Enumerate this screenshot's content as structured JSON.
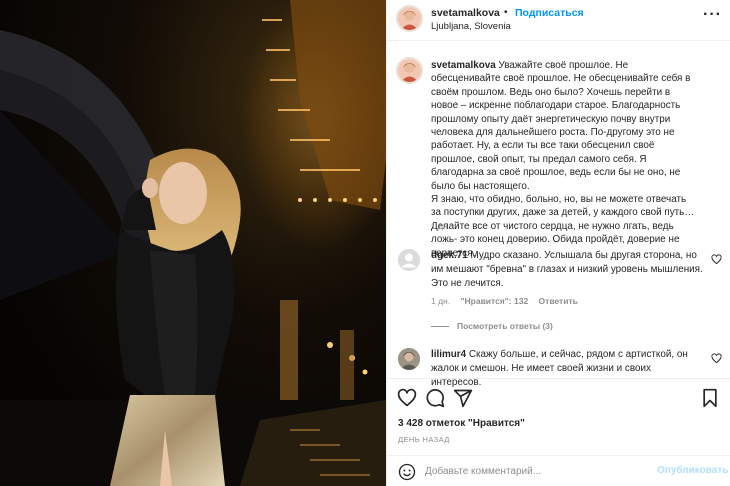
{
  "post": {
    "username": "svetamalkova",
    "dot": "•",
    "follow_label": "Подписаться",
    "location": "Ljubljana, Slovenia",
    "more_label": "···"
  },
  "caption": {
    "username": "svetamalkova",
    "text": "Уважайте своё прошлое. Не обесценивайте своё прошлое. Не обесценивайте себя в своём прошлом. Ведь оно было? Хочешь перейти в новое – искренне поблагодари старое. Благодарность прошлому опыту даёт энергетическую почву внутри человека для дальнейшего роста. По-другому это не работает. Ну, а если ты все таки обесценил своё прошлое, свой опыт, ты предал самого себя. Я благодарна за своё прошлое, ведь если бы не оно, не было бы настоящего.",
    "text2": "Я знаю, что обидно, больно, но, вы не можете отвечать за поступки других, даже за детей, у каждого свой путь…Делайте все от чистого сердца, не нужно лгать, ведь ложь- это конец доверию. Обида пройдёт, доверие не вернется…",
    "time": "1 дн."
  },
  "comments": [
    {
      "username": "dgek.71",
      "text": "Мудро сказано. Услышала бы другая сторона, но им мешают \"бревна\" в глазах и низкий уровень мышления. Это не лечится.",
      "time": "1 дн.",
      "likes": "\"Нравится\": 132",
      "reply": "Ответить",
      "view_replies": "Посмотреть ответы (3)"
    },
    {
      "username": "lilimur4",
      "text": "Скажу больше, и сейчас, рядом с артисткой, он жалок и смешон. Не имеет своей жизни и своих интересов."
    }
  ],
  "stats": {
    "likes": "3 428 отметок \"Нравится\"",
    "date": "ДЕНЬ НАЗАД"
  },
  "comment_box": {
    "placeholder": "Добавьте комментарий...",
    "publish_label": "Опубликовать"
  },
  "icons": {
    "like": "heart-icon",
    "comment": "comment-icon",
    "share": "paper-plane-icon",
    "save": "bookmark-icon",
    "emoji": "smiley-icon"
  },
  "colors": {
    "link": "#0095f6",
    "publish_disabled": "#b2dffc",
    "secondary_text": "#8e8e8e"
  }
}
